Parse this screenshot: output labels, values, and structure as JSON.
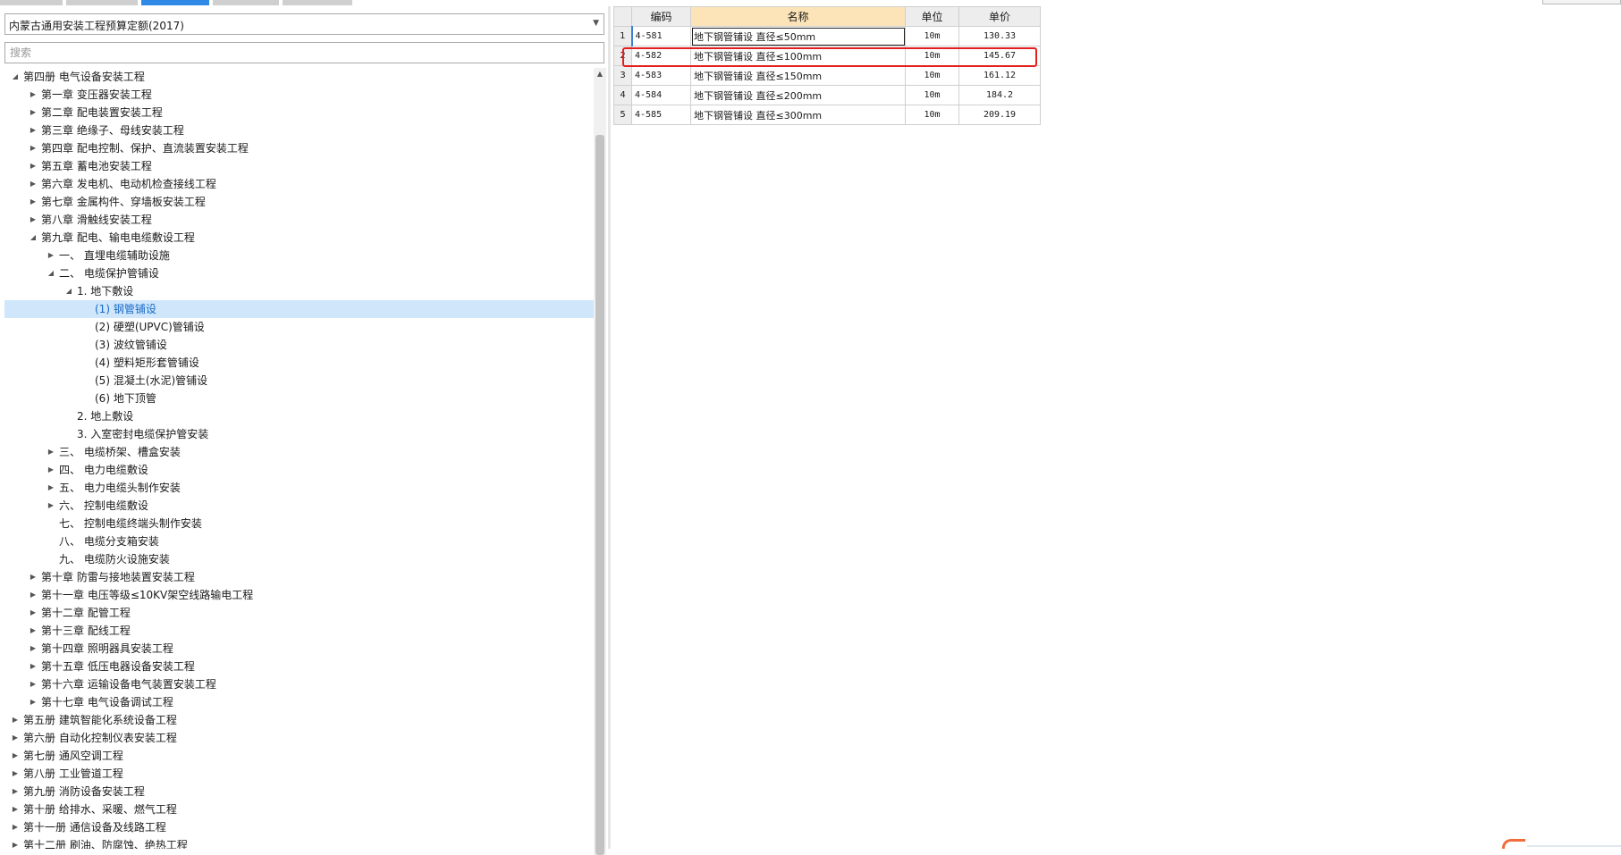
{
  "quota_select": {
    "value": "内蒙古通用安装工程预算定额(2017)"
  },
  "search": {
    "placeholder": "搜索"
  },
  "tree": [
    {
      "level": 0,
      "toggle": "expanded",
      "label": "第四册 电气设备安装工程"
    },
    {
      "level": 1,
      "toggle": "collapsed",
      "label": "第一章 变压器安装工程"
    },
    {
      "level": 1,
      "toggle": "collapsed",
      "label": "第二章 配电装置安装工程"
    },
    {
      "level": 1,
      "toggle": "collapsed",
      "label": "第三章 绝缘子、母线安装工程"
    },
    {
      "level": 1,
      "toggle": "collapsed",
      "label": "第四章 配电控制、保护、直流装置安装工程"
    },
    {
      "level": 1,
      "toggle": "collapsed",
      "label": "第五章 蓄电池安装工程"
    },
    {
      "level": 1,
      "toggle": "collapsed",
      "label": "第六章 发电机、电动机检查接线工程"
    },
    {
      "level": 1,
      "toggle": "collapsed",
      "label": "第七章 金属构件、穿墙板安装工程"
    },
    {
      "level": 1,
      "toggle": "collapsed",
      "label": "第八章 滑触线安装工程"
    },
    {
      "level": 1,
      "toggle": "expanded",
      "label": "第九章 配电、输电电缆敷设工程"
    },
    {
      "level": 2,
      "toggle": "collapsed",
      "label": "一、 直埋电缆辅助设施"
    },
    {
      "level": 2,
      "toggle": "expanded",
      "label": "二、 电缆保护管铺设"
    },
    {
      "level": 3,
      "toggle": "expanded",
      "label": "1. 地下敷设"
    },
    {
      "level": 4,
      "toggle": "none",
      "label": "(1) 钢管铺设",
      "selected": true
    },
    {
      "level": 4,
      "toggle": "none",
      "label": "(2) 硬塑(UPVC)管铺设"
    },
    {
      "level": 4,
      "toggle": "none",
      "label": "(3) 波纹管铺设"
    },
    {
      "level": 4,
      "toggle": "none",
      "label": "(4) 塑料矩形套管铺设"
    },
    {
      "level": 4,
      "toggle": "none",
      "label": "(5) 混凝土(水泥)管铺设"
    },
    {
      "level": 4,
      "toggle": "none",
      "label": "(6) 地下顶管"
    },
    {
      "level": 3,
      "toggle": "none",
      "label": "2. 地上敷设"
    },
    {
      "level": 3,
      "toggle": "none",
      "label": "3. 入室密封电缆保护管安装"
    },
    {
      "level": 2,
      "toggle": "collapsed",
      "label": "三、 电缆桥架、槽盒安装"
    },
    {
      "level": 2,
      "toggle": "collapsed",
      "label": "四、 电力电缆敷设"
    },
    {
      "level": 2,
      "toggle": "collapsed",
      "label": "五、 电力电缆头制作安装"
    },
    {
      "level": 2,
      "toggle": "collapsed",
      "label": "六、 控制电缆敷设"
    },
    {
      "level": 2,
      "toggle": "none",
      "label": "七、 控制电缆终端头制作安装"
    },
    {
      "level": 2,
      "toggle": "none",
      "label": "八、 电缆分支箱安装"
    },
    {
      "level": 2,
      "toggle": "none",
      "label": "九、 电缆防火设施安装"
    },
    {
      "level": 1,
      "toggle": "collapsed",
      "label": "第十章 防雷与接地装置安装工程"
    },
    {
      "level": 1,
      "toggle": "collapsed",
      "label": "第十一章 电压等级≤10KV架空线路输电工程"
    },
    {
      "level": 1,
      "toggle": "collapsed",
      "label": "第十二章 配管工程"
    },
    {
      "level": 1,
      "toggle": "collapsed",
      "label": "第十三章 配线工程"
    },
    {
      "level": 1,
      "toggle": "collapsed",
      "label": "第十四章 照明器具安装工程"
    },
    {
      "level": 1,
      "toggle": "collapsed",
      "label": "第十五章 低压电器设备安装工程"
    },
    {
      "level": 1,
      "toggle": "collapsed",
      "label": "第十六章 运输设备电气装置安装工程"
    },
    {
      "level": 1,
      "toggle": "collapsed",
      "label": "第十七章 电气设备调试工程"
    },
    {
      "level": 0,
      "toggle": "collapsed",
      "label": "第五册 建筑智能化系统设备工程"
    },
    {
      "level": 0,
      "toggle": "collapsed",
      "label": "第六册 自动化控制仪表安装工程"
    },
    {
      "level": 0,
      "toggle": "collapsed",
      "label": "第七册 通风空调工程"
    },
    {
      "level": 0,
      "toggle": "collapsed",
      "label": "第八册 工业管道工程"
    },
    {
      "level": 0,
      "toggle": "collapsed",
      "label": "第九册 消防设备安装工程"
    },
    {
      "level": 0,
      "toggle": "collapsed",
      "label": "第十册 给排水、采暖、燃气工程"
    },
    {
      "level": 0,
      "toggle": "collapsed",
      "label": "第十一册 通信设备及线路工程"
    },
    {
      "level": 0,
      "toggle": "collapsed",
      "label": "第十二册 刷油、防腐蚀、绝热工程"
    }
  ],
  "grid": {
    "headers": {
      "code": "编码",
      "name": "名称",
      "unit": "单位",
      "price": "单价"
    },
    "rows": [
      {
        "num": "1",
        "code": "4-581",
        "name": "地下钢管铺设 直径≤50mm",
        "unit": "10m",
        "price": "130.33"
      },
      {
        "num": "2",
        "code": "4-582",
        "name": "地下钢管铺设 直径≤100mm",
        "unit": "10m",
        "price": "145.67"
      },
      {
        "num": "3",
        "code": "4-583",
        "name": "地下钢管铺设 直径≤150mm",
        "unit": "10m",
        "price": "161.12"
      },
      {
        "num": "4",
        "code": "4-584",
        "name": "地下钢管铺设 直径≤200mm",
        "unit": "10m",
        "price": "184.2"
      },
      {
        "num": "5",
        "code": "4-585",
        "name": "地下钢管铺设 直径≤300mm",
        "unit": "10m",
        "price": "209.19"
      }
    ],
    "highlighted_row": 2
  },
  "colors": {
    "accent": "#2e8ae6",
    "selection": "#cfe6fb",
    "highlight_border": "#e31e1e",
    "name_header": "#fde4b8"
  }
}
